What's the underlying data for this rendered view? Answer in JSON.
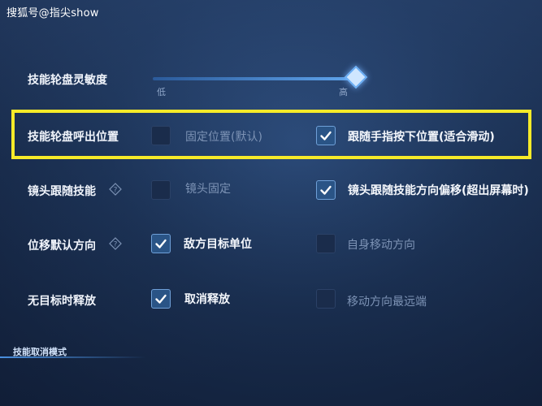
{
  "watermark": "搜狐号@指尖show",
  "sensitivity": {
    "label": "技能轮盘灵敏度",
    "low_label": "低",
    "high_label": "高",
    "level": 1.0
  },
  "rows": [
    {
      "label": "技能轮盘呼出位置",
      "options": [
        {
          "text": "固定位置(默认)",
          "checked": false
        },
        {
          "text": "跟随手指按下位置(适合滑动)",
          "checked": true
        }
      ]
    },
    {
      "label": "镜头跟随技能",
      "help_icon": "question-diamond-icon",
      "options": [
        {
          "text": "镜头固定",
          "checked": false
        },
        {
          "text": "镜头跟随技能方向偏移(超出屏幕时)",
          "checked": true
        }
      ]
    },
    {
      "label": "位移默认方向",
      "help_icon": "question-diamond-icon",
      "options": [
        {
          "text": "敌方目标单位",
          "checked": true
        },
        {
          "text": "自身移动方向",
          "checked": false
        }
      ]
    },
    {
      "label": "无目标时释放",
      "options": [
        {
          "text": "取消释放",
          "checked": true
        },
        {
          "text": "移动方向最远端",
          "checked": false
        }
      ]
    }
  ],
  "section_title": "技能取消模式",
  "colors": {
    "highlight": "#f6ea29",
    "accent": "#5fa4ec",
    "background": "#1d3458"
  }
}
